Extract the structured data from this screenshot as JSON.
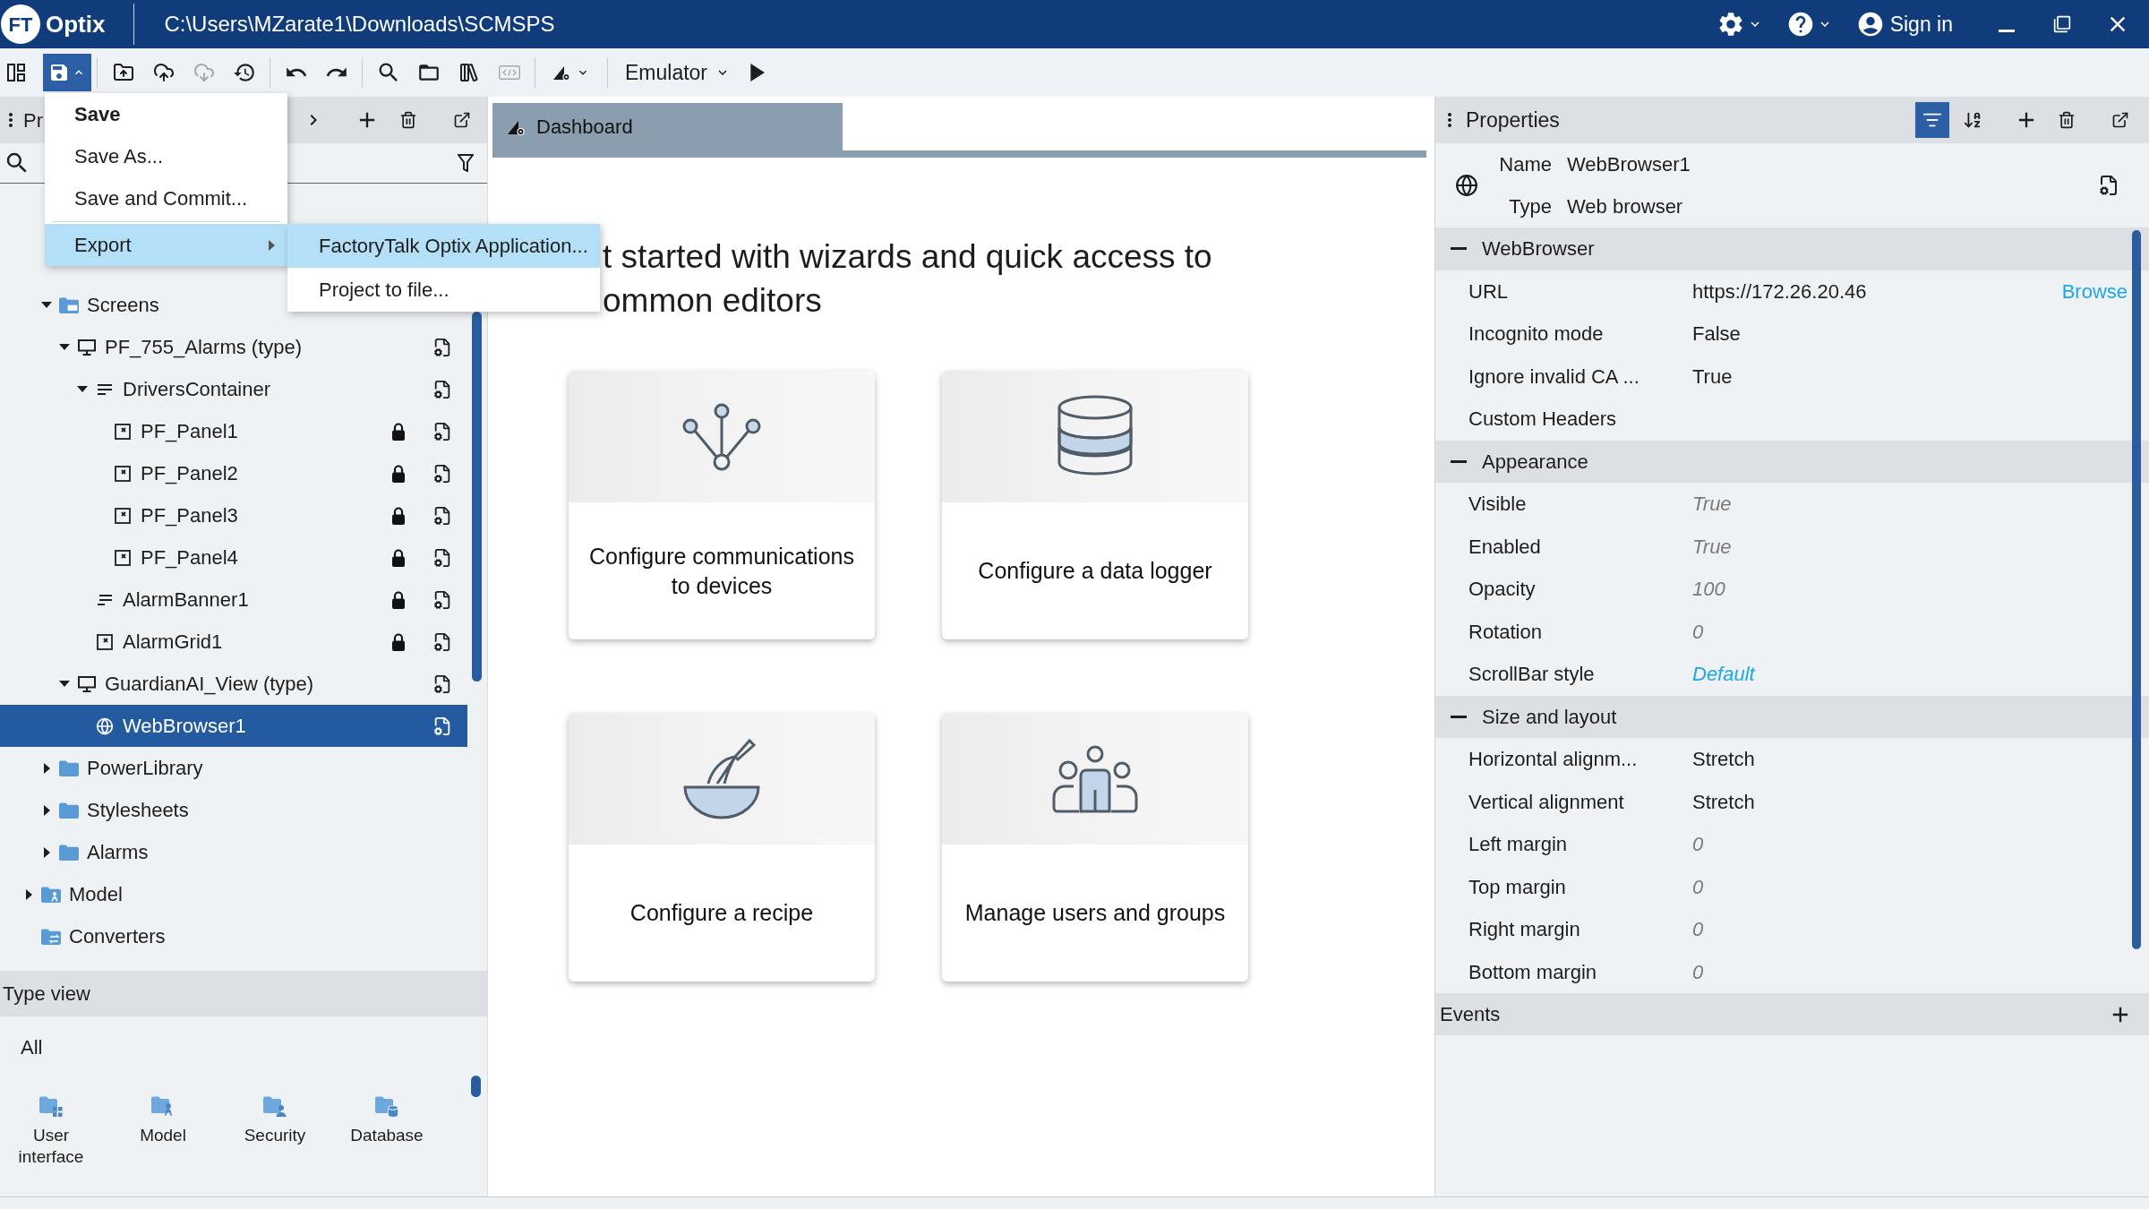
{
  "title_bar": {
    "logo_mark": "FT",
    "app_name": "Optix",
    "path": "C:\\Users\\MZarate1\\Downloads\\SCMSPS",
    "sign_in": "Sign in"
  },
  "toolbar": {
    "items": [
      {
        "kind": "layout",
        "disabled": false
      },
      {
        "kind": "save",
        "disabled": false
      },
      {
        "kind": "separator"
      },
      {
        "kind": "export",
        "disabled": false
      },
      {
        "kind": "upload",
        "disabled": false
      },
      {
        "kind": "download",
        "disabled": true
      },
      {
        "kind": "history",
        "disabled": false
      },
      {
        "kind": "separator"
      },
      {
        "kind": "undo",
        "disabled": false
      },
      {
        "kind": "redo",
        "disabled": false
      },
      {
        "kind": "separator"
      },
      {
        "kind": "search",
        "disabled": false
      },
      {
        "kind": "folder",
        "disabled": false
      },
      {
        "kind": "library",
        "disabled": false
      },
      {
        "kind": "code",
        "disabled": true
      },
      {
        "kind": "separator"
      },
      {
        "kind": "style",
        "disabled": false
      },
      {
        "kind": "separator"
      },
      {
        "kind": "target",
        "label": "Emulator",
        "disabled": false
      },
      {
        "kind": "run",
        "disabled": false
      }
    ]
  },
  "save_menu": {
    "open": true,
    "items": [
      {
        "kind": "item",
        "label": "Save",
        "default": true,
        "highlighted": false
      },
      {
        "kind": "item",
        "label": "Save As...",
        "default": false,
        "highlighted": false
      },
      {
        "kind": "item",
        "label": "Save and Commit...",
        "default": false,
        "highlighted": false
      },
      {
        "kind": "separator"
      },
      {
        "kind": "item",
        "label": "Export",
        "default": false,
        "highlighted": true,
        "submenu": [
          {
            "label": "FactoryTalk Optix Application...",
            "highlighted": true
          },
          {
            "label": "Project to file...",
            "highlighted": false
          }
        ]
      }
    ]
  },
  "project_panel": {
    "title": "Pr",
    "tree": [
      {
        "children": [
          {
            "label": "Screens",
            "kind": "screens_folder",
            "expanded": true,
            "locked": false,
            "selected": false,
            "children": [
              {
                "label": "PF_755_Alarms (type)",
                "kind": "screen",
                "expanded": true,
                "locked": false,
                "selected": false,
                "children": [
                  {
                    "label": "DriversContainer",
                    "kind": "container",
                    "expanded": true,
                    "locked": false,
                    "selected": false,
                    "children": [
                      {
                        "label": "PF_Panel1",
                        "kind": "panel",
                        "locked": true,
                        "selected": false
                      },
                      {
                        "label": "PF_Panel2",
                        "kind": "panel",
                        "locked": true,
                        "selected": false
                      },
                      {
                        "label": "PF_Panel3",
                        "kind": "panel",
                        "locked": true,
                        "selected": false
                      },
                      {
                        "label": "PF_Panel4",
                        "kind": "panel",
                        "locked": true,
                        "selected": false
                      }
                    ]
                  },
                  {
                    "label": "AlarmBanner1",
                    "kind": "banner",
                    "locked": true,
                    "selected": false
                  },
                  {
                    "label": "AlarmGrid1",
                    "kind": "panel",
                    "locked": true,
                    "selected": false
                  }
                ]
              },
              {
                "label": "GuardianAI_View (type)",
                "kind": "screen",
                "expanded": true,
                "locked": false,
                "selected": false,
                "children": [
                  {
                    "label": "WebBrowser1",
                    "kind": "web",
                    "locked": false,
                    "selected": true
                  }
                ]
              }
            ]
          },
          {
            "label": "PowerLibrary",
            "kind": "folder",
            "expanded": false,
            "locked": false,
            "selected": false
          },
          {
            "label": "Stylesheets",
            "kind": "folder",
            "expanded": false,
            "locked": false,
            "selected": false
          },
          {
            "label": "Alarms",
            "kind": "folder",
            "expanded": false,
            "locked": false,
            "selected": false
          }
        ]
      },
      {
        "label": "Model",
        "kind": "model_folder",
        "expanded": false,
        "locked": false,
        "selected": false
      },
      {
        "label": "Converters",
        "kind": "converter_folder",
        "locked": false,
        "selected": false
      }
    ]
  },
  "type_view": {
    "title": "Type view",
    "filter": "All",
    "items": [
      {
        "label": "User interface",
        "kind": "ui"
      },
      {
        "label": "Model",
        "kind": "model"
      },
      {
        "label": "Security",
        "kind": "security"
      },
      {
        "label": "Database",
        "kind": "database"
      }
    ]
  },
  "center": {
    "tabs": [
      {
        "label": "Dashboard",
        "selected": true
      }
    ],
    "heading": [
      "t started with wizards and quick access to",
      "ommon editors"
    ],
    "cards": [
      {
        "label": "Configure communications to devices",
        "kind": "communications"
      },
      {
        "label": "Configure a data logger",
        "kind": "datalogger"
      },
      {
        "label": "Configure a recipe",
        "kind": "recipe"
      },
      {
        "label": "Manage users and groups",
        "kind": "users"
      }
    ]
  },
  "properties": {
    "title": "Properties",
    "view_buttons": [
      {
        "kind": "categorized",
        "selected": true
      },
      {
        "kind": "alphabetical",
        "selected": false
      }
    ],
    "object": {
      "name_label": "Name",
      "name": "WebBrowser1",
      "type_label": "Type",
      "type": "Web browser"
    },
    "sections": [
      {
        "title": "WebBrowser",
        "expanded": true,
        "rows": [
          {
            "label": "URL",
            "value": "https://172.26.20.46",
            "kind": "set",
            "action": "Browse"
          },
          {
            "label": "Incognito mode",
            "value": "False",
            "kind": "set"
          },
          {
            "label": "Ignore invalid CA ...",
            "value": "True",
            "kind": "set"
          },
          {
            "label": "Custom Headers"
          }
        ]
      },
      {
        "title": "Appearance",
        "expanded": true,
        "rows": [
          {
            "label": "Visible",
            "value": "True",
            "kind": "default"
          },
          {
            "label": "Enabled",
            "value": "True",
            "kind": "default"
          },
          {
            "label": "Opacity",
            "value": "100",
            "kind": "default"
          },
          {
            "label": "Rotation",
            "value": "0",
            "kind": "default"
          },
          {
            "label": "ScrollBar style",
            "value": "Default",
            "kind": "reference"
          }
        ]
      },
      {
        "title": "Size and layout",
        "expanded": true,
        "rows": [
          {
            "label": "Horizontal alignm...",
            "value": "Stretch",
            "kind": "set"
          },
          {
            "label": "Vertical alignment",
            "value": "Stretch",
            "kind": "set"
          },
          {
            "label": "Left margin",
            "value": "0",
            "kind": "default"
          },
          {
            "label": "Top margin",
            "value": "0",
            "kind": "default"
          },
          {
            "label": "Right margin",
            "value": "0",
            "kind": "default"
          },
          {
            "label": "Bottom margin",
            "value": "0",
            "kind": "default"
          }
        ]
      }
    ],
    "events": {
      "title": "Events"
    }
  }
}
